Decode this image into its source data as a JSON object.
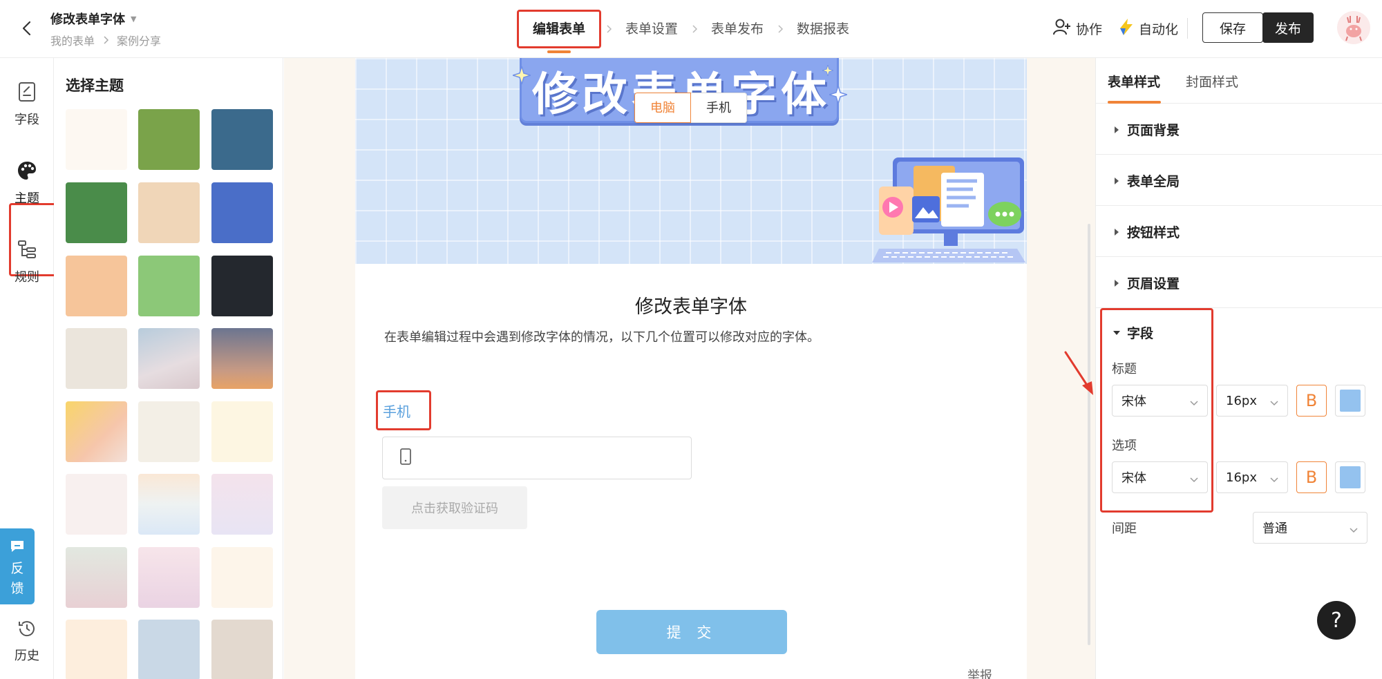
{
  "header": {
    "title": "修改表单字体",
    "breadcrumb": [
      "我的表单",
      "案例分享"
    ],
    "steps": [
      "编辑表单",
      "表单设置",
      "表单发布",
      "数据报表"
    ],
    "collab_label": "协作",
    "automation_label": "自动化",
    "save_label": "保存",
    "publish_label": "发布"
  },
  "rail": {
    "items": [
      {
        "label": "字段",
        "icon": "field-icon"
      },
      {
        "label": "主题",
        "icon": "palette-icon"
      },
      {
        "label": "规则",
        "icon": "rules-icon"
      },
      {
        "label": "历史",
        "icon": "history-icon"
      }
    ],
    "feedback_label": [
      "反",
      "馈"
    ]
  },
  "theme_panel": {
    "title": "选择主题",
    "swatches": [
      {
        "bg": "#fdf8f2"
      },
      {
        "bg": "#7aa34a"
      },
      {
        "bg": "#3b6a8c"
      },
      {
        "bg": "#4a8c4a"
      },
      {
        "bg": "#f0d6b8"
      },
      {
        "bg": "#4a6ec8"
      },
      {
        "bg": "#f6c59a"
      },
      {
        "bg": "#8cc878"
      },
      {
        "bg": "#24282e"
      },
      {
        "bg": "#ebe5dc"
      },
      {
        "bg": "linear-gradient(160deg,#b8ccdc,#e6dde0 60%,#d8c8cc)"
      },
      {
        "bg": "linear-gradient(180deg,#6c7590,#c79a84 70%,#e8a366)"
      },
      {
        "bg": "linear-gradient(135deg,#f8d56a,#f6c6ab 60%,#f3e0d8)"
      },
      {
        "bg": "#f3efe6"
      },
      {
        "bg": "#fdf6e2"
      },
      {
        "bg": "#f8f0ef"
      },
      {
        "bg": "linear-gradient(180deg,#fae8d6,#eef2f2 50%,#dbe8f6)"
      },
      {
        "bg": "linear-gradient(180deg,#f4e3ec,#e8e4f4)"
      },
      {
        "bg": "linear-gradient(180deg,#e2e8e0,#e8d0d4)"
      },
      {
        "bg": "linear-gradient(180deg,#f7e5ea,#ead3e3)"
      },
      {
        "bg": "#fdf5ea"
      },
      {
        "bg": "#fdeedd"
      },
      {
        "bg": "#c9d8e6"
      },
      {
        "bg": "#e3d9cf"
      }
    ]
  },
  "form": {
    "banner_title": "修改表单字体",
    "device_toggle": {
      "pc": "电脑",
      "mobile": "手机"
    },
    "heading": "修改表单字体",
    "description": "在表单编辑过程中会遇到修改字体的情况，以下几个位置可以修改对应的字体。",
    "field_label": "手机",
    "code_button": "点击获取验证码",
    "submit_label": "提 交",
    "report_label": "举报"
  },
  "right_panel": {
    "tabs": [
      "表单样式",
      "封面样式"
    ],
    "sections": [
      "页面背景",
      "表单全局",
      "按钮样式",
      "页眉设置"
    ],
    "field_section": {
      "title": "字段",
      "title_label": "标题",
      "title_font": "宋体",
      "title_size": "16px",
      "option_label": "选项",
      "option_font": "宋体",
      "option_size": "16px",
      "bold_glyph": "B",
      "spacing_label": "间距",
      "spacing_value": "普通",
      "color_swatch": "#94c2ef"
    }
  },
  "help_glyph": "?",
  "accent_color": "#f08438",
  "highlight_color": "#e23b2e"
}
